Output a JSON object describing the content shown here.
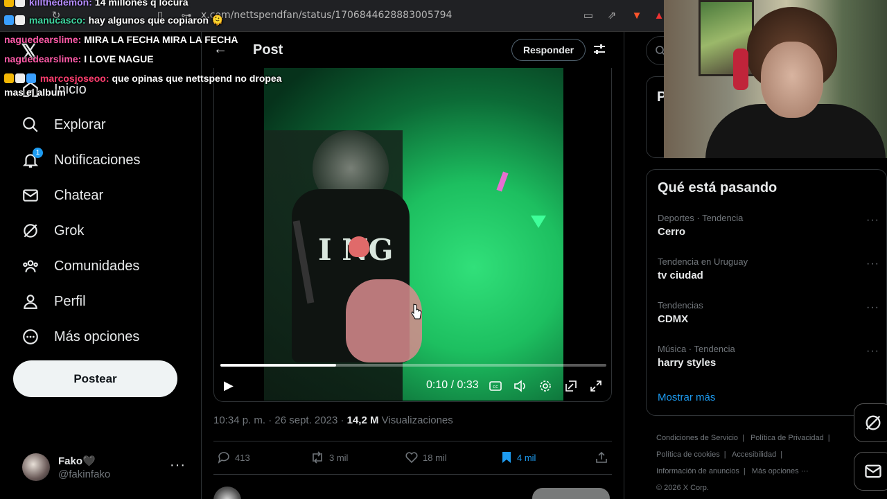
{
  "browser": {
    "url": "x.com/nettspendfan/status/1706844628883005794"
  },
  "nav": {
    "items": [
      {
        "label": "Inicio"
      },
      {
        "label": "Explorar"
      },
      {
        "label": "Notificaciones",
        "badge": "1"
      },
      {
        "label": "Chatear"
      },
      {
        "label": "Grok"
      },
      {
        "label": "Comunidades"
      },
      {
        "label": "Perfil"
      },
      {
        "label": "Más opciones"
      }
    ],
    "post_button": "Postear",
    "profile": {
      "name": "Fako🖤",
      "handle": "@fakinfako",
      "more": "···"
    }
  },
  "header": {
    "title": "Post",
    "reply_button": "Responder"
  },
  "video": {
    "shirt_text": "I NG",
    "progress": 0.3,
    "time": "0:10 / 0:33"
  },
  "tweet": {
    "timestamp": "10:34 p. m. · 26 sept. 2023 · ",
    "views_count": "14,2 M",
    "views_label": " Visualizaciones",
    "stats": {
      "replies": "413",
      "reposts": "3 mil",
      "likes": "18 mil",
      "bookmarks": "4 mil"
    }
  },
  "right": {
    "premium_initial": "P",
    "trends_title": "Qué está pasando",
    "trends": [
      {
        "category": "Deportes · Tendencia",
        "name": "Cerro"
      },
      {
        "category": "Tendencia en Uruguay",
        "name": "tv ciudad"
      },
      {
        "category": "Tendencias",
        "name": "CDMX"
      },
      {
        "category": "Música · Tendencia",
        "name": "harry styles"
      }
    ],
    "show_more": "Mostrar más",
    "footer": [
      "Condiciones de Servicio",
      "|",
      "Política de Privacidad",
      "|",
      "Política de cookies",
      "|",
      "Accesibilidad",
      "|",
      "Información de anuncios",
      "|",
      "Más opciones ···",
      "© 2026 X Corp."
    ]
  },
  "chat": [
    {
      "user": "killthedemon:",
      "message": "14 millones q locura",
      "color": "#b58cff"
    },
    {
      "user": "manucasco:",
      "message": "hay algunos que copiaron 🫠",
      "color": "#3fd6a0"
    },
    {
      "user": "naguedearslime:",
      "message": "MIRA LA FECHA MIRA LA FECHA",
      "color": "#ff5aa8"
    },
    {
      "user": "naguedearslime:",
      "message": "I LOVE NAGUE",
      "color": "#ff5aa8"
    },
    {
      "user": "marcosjoseoo:",
      "message": "que opinas que nettspend no dropea",
      "color": "#ff3d6e"
    },
    {
      "user": "",
      "message": "mas el album",
      "color": "#ffffff"
    }
  ],
  "colors": {
    "accent": "#1d9bf0",
    "background": "#000000",
    "text": "#e7e9ea",
    "muted": "#71767b"
  }
}
